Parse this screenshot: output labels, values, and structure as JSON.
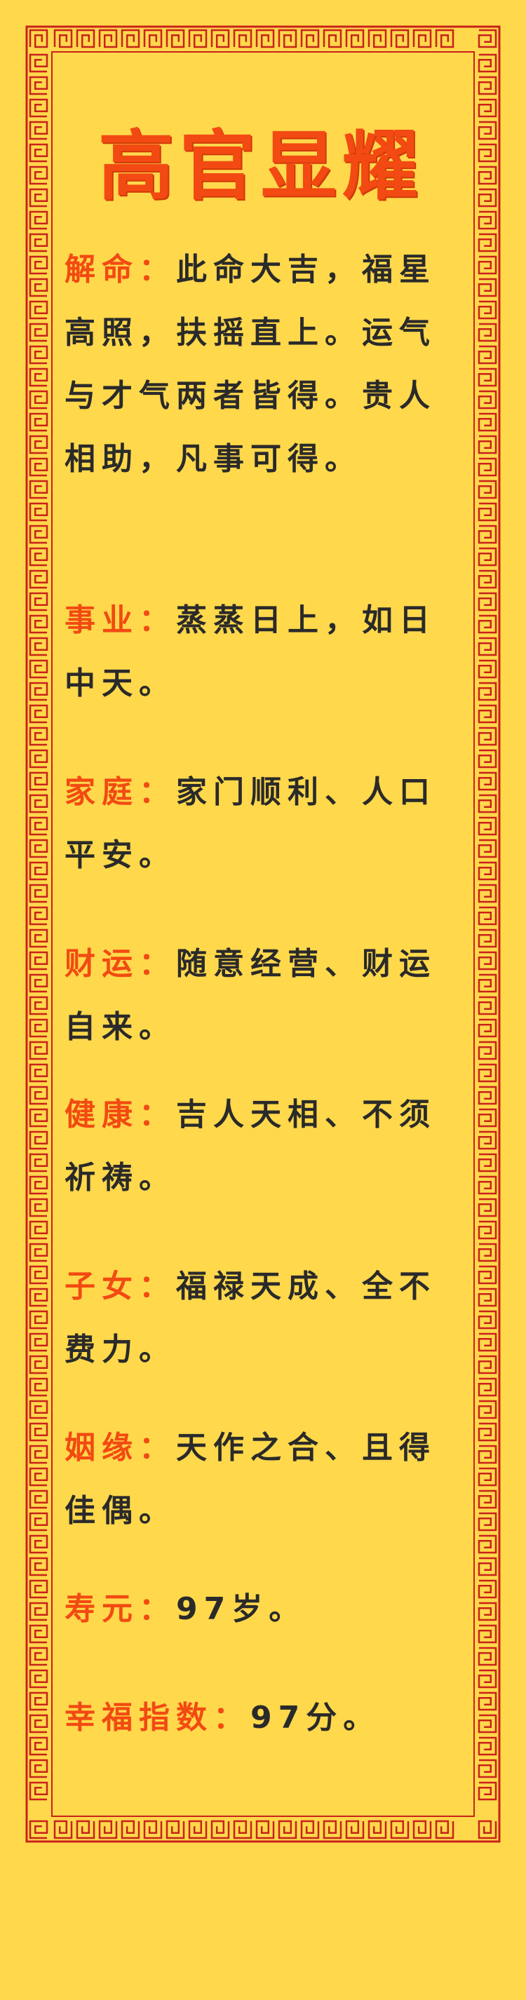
{
  "title": "高官显耀",
  "entries": [
    {
      "label": "解命：",
      "text": "此命大吉，福星高照，扶摇直上。运气与才气两者皆得。贵人相助，凡事可得。"
    },
    {
      "label": "事业：",
      "text": "蒸蒸日上，如日中天。"
    },
    {
      "label": "家庭：",
      "text": "家门顺利、人口平安。"
    },
    {
      "label": "财运：",
      "text": "随意经营、财运自来。"
    },
    {
      "label": "健康：",
      "text": "吉人天相、不须祈祷。"
    },
    {
      "label": "子女：",
      "text": "福禄天成、全不费力。"
    },
    {
      "label": "姻缘：",
      "text": "天作之合、且得佳偶。"
    },
    {
      "label": "寿元：",
      "text": "97岁。"
    },
    {
      "label": "幸福指数：",
      "text": "97分。"
    }
  ],
  "colors": {
    "background": "#FFD84C",
    "accent": "#F24A12",
    "border": "#C8221A",
    "text": "#2a2a2a"
  }
}
